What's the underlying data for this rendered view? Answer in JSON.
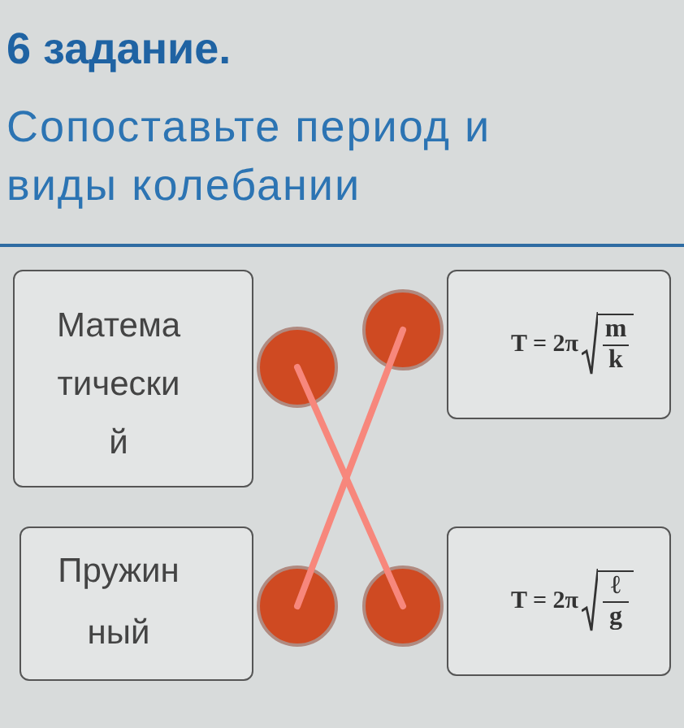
{
  "task_title": "6 задание.",
  "instruction": "Сопоставьте период и виды колебании",
  "left_items": [
    {
      "text": "Математический",
      "line_down": true
    },
    {
      "text": "Пружинный",
      "line_down": false
    }
  ],
  "right_items": [
    {
      "prefix": "T = 2π",
      "numerator": "m",
      "denominator": "k"
    },
    {
      "prefix": "T = 2π",
      "numerator": "ℓ",
      "denominator": "g"
    }
  ]
}
